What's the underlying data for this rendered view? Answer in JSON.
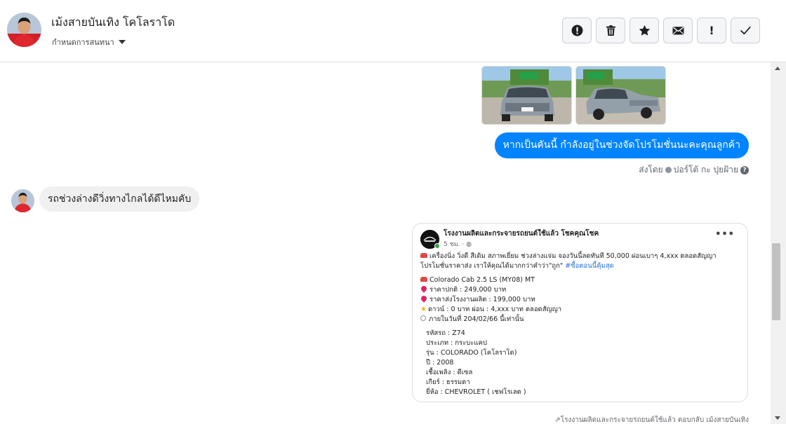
{
  "header": {
    "title": "เม้งสายบันเทิง โคโลราโด",
    "subtitle": "กำหนดการสนทนา",
    "toolbar": [
      {
        "name": "alert-circle-button",
        "icon": "alert-circle-icon",
        "label": ""
      },
      {
        "name": "delete-button",
        "icon": "trash-icon",
        "label": ""
      },
      {
        "name": "star-button",
        "icon": "star-icon",
        "label": ""
      },
      {
        "name": "mail-button",
        "icon": "envelope-icon",
        "label": ""
      },
      {
        "name": "important-button",
        "icon": "exclamation-icon",
        "label": "!"
      },
      {
        "name": "done-button",
        "icon": "checkmark-icon",
        "label": ""
      }
    ]
  },
  "messages": {
    "outgoing_text": "หากเป็นคันนี้ กำลังอยู่ในช่วงจัดโปรโมชั่นนะคะคุณลูกค้า",
    "sent_by_prefix": "ส่งโดย",
    "sent_by_name": "ปอร์โต้ กะ ปุยฝ้าย",
    "incoming_text": "รถช่วงล่างดีวิ่งทางไกลได้ดีไหมคับ",
    "footer_note": "โรงงานผลิตและกระจายรถยนต์ใช้แล้ว ตอบกลับ เม้งสายบันเทิง"
  },
  "post": {
    "page_name": "โรงงานผลิตและกระจายรถยนต์ใช้แล้ว โชคคุณโชค",
    "meta": "5 ชม. · ",
    "intro": "เครื่องนิ่ง วิ่งดี สีเดิม สภาพเยี่ยม ช่วงล่างแจ่ม  จองวันนี้ลดทันที 50,000 ผ่อนเบาๆ 4,xxx ตลอดสัญญา",
    "intro2": "โปรโมชั่นราคาส่ง เราให้คุณได้มากกว่าคำว่า\"ถูก\" ",
    "hashtag": "#ซื้อตอนนี้คุ้มสุด",
    "model": "Colorado Cab 2.5 LS (MY08) MT",
    "normal_price": "ราคาปกติ : 249,000  บาท",
    "factory_price": "ราคาส่งโรงงานผลิต : 199,000 บาท",
    "down_payment": "ดาวน์ : 0 บาท ผ่อน : 4,xxx บาท ตลอดสัญญา",
    "deadline": "ภายในวันที่ 204/02/66 นี้เท่านั้น",
    "specs": [
      "รหัสรถ : Z74",
      "ประเภท : กระบะแคป",
      "รุ่น : COLORADO (โคโลราโด)",
      "ปี : 2008",
      "เชื้อเพลิง : ดีเซล",
      "เกียร์ : ธรรมดา",
      "ยี่ห้อ : CHEVROLET ( เชฟโรเลต )"
    ]
  },
  "colors": {
    "accent": "#0084ff",
    "bubble_in": "#f0f0f0",
    "hashtag": "#216fdb"
  }
}
